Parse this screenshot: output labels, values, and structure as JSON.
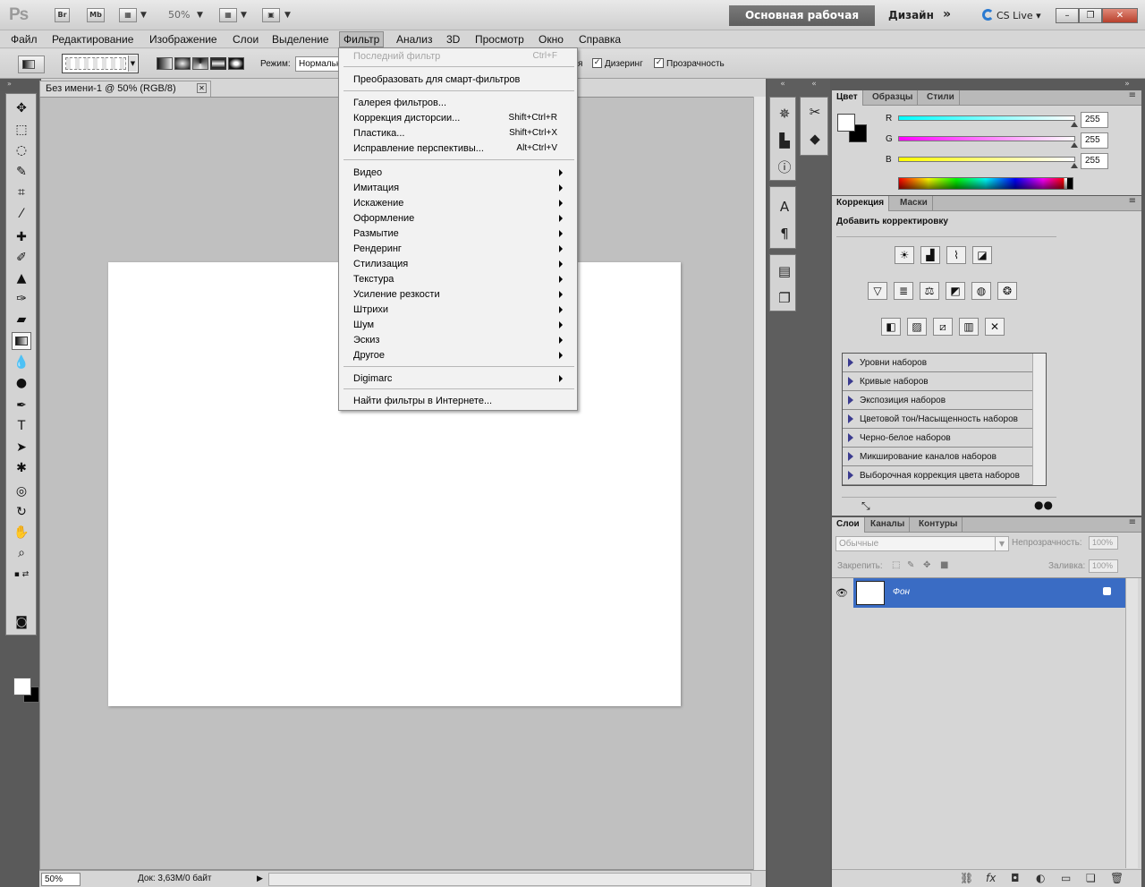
{
  "app": {
    "logo": "Ps",
    "bridge_label": "Br",
    "minibridge_label": "Mb",
    "zoom": "50%",
    "workspace_active": "Основная рабочая среда",
    "workspace_design": "Дизайн",
    "workspace_more": "»",
    "cs_live": "CS Live"
  },
  "menubar": [
    "Файл",
    "Редактирование",
    "Изображение",
    "Слои",
    "Выделение",
    "Фильтр",
    "Анализ",
    "3D",
    "Просмотр",
    "Окно",
    "Справка"
  ],
  "options": {
    "mode_label": "Режим:",
    "mode_value": "Нормальный",
    "dither_label": "Дизеринг",
    "transparency_label": "Прозрачность",
    "partial_label": "я"
  },
  "filter_menu": {
    "last_filter": "Последний фильтр",
    "last_filter_shortcut": "Ctrl+F",
    "smart": "Преобразовать для смарт-фильтров",
    "gallery": "Галерея фильтров...",
    "lens": "Коррекция дисторсии...",
    "lens_shortcut": "Shift+Ctrl+R",
    "liquify": "Пластика...",
    "liquify_shortcut": "Shift+Ctrl+X",
    "vanishing": "Исправление перспективы...",
    "vanishing_shortcut": "Alt+Ctrl+V",
    "submenus": [
      "Видео",
      "Имитация",
      "Искажение",
      "Оформление",
      "Размытие",
      "Рендеринг",
      "Стилизация",
      "Текстура",
      "Усиление резкости",
      "Штрихи",
      "Шум",
      "Эскиз",
      "Другое"
    ],
    "digimarc": "Digimarc",
    "online": "Найти фильтры в Интернете..."
  },
  "document": {
    "tab_title": "Без имени-1 @ 50% (RGB/8)",
    "status_zoom": "50%",
    "status_doc": "Док: 3,63M/0 байт"
  },
  "color_panel": {
    "tabs": [
      "Цвет",
      "Образцы",
      "Стили"
    ],
    "r_label": "R",
    "g_label": "G",
    "b_label": "B",
    "r_value": "255",
    "g_value": "255",
    "b_value": "255"
  },
  "adjust_panel": {
    "tabs": [
      "Коррекция",
      "Маски"
    ],
    "title": "Добавить корректировку",
    "presets": [
      "Уровни наборов",
      "Кривые наборов",
      "Экспозиция наборов",
      "Цветовой тон/Насыщенность наборов",
      "Черно-белое наборов",
      "Микширование каналов наборов",
      "Выборочная коррекция цвета наборов"
    ]
  },
  "layers_panel": {
    "tabs": [
      "Слои",
      "Каналы",
      "Контуры"
    ],
    "blend_mode": "Обычные",
    "opacity_label": "Непрозрачность:",
    "opacity_value": "100%",
    "lock_label": "Закрепить:",
    "fill_label": "Заливка:",
    "fill_value": "100%",
    "layer_name": "Фон"
  }
}
